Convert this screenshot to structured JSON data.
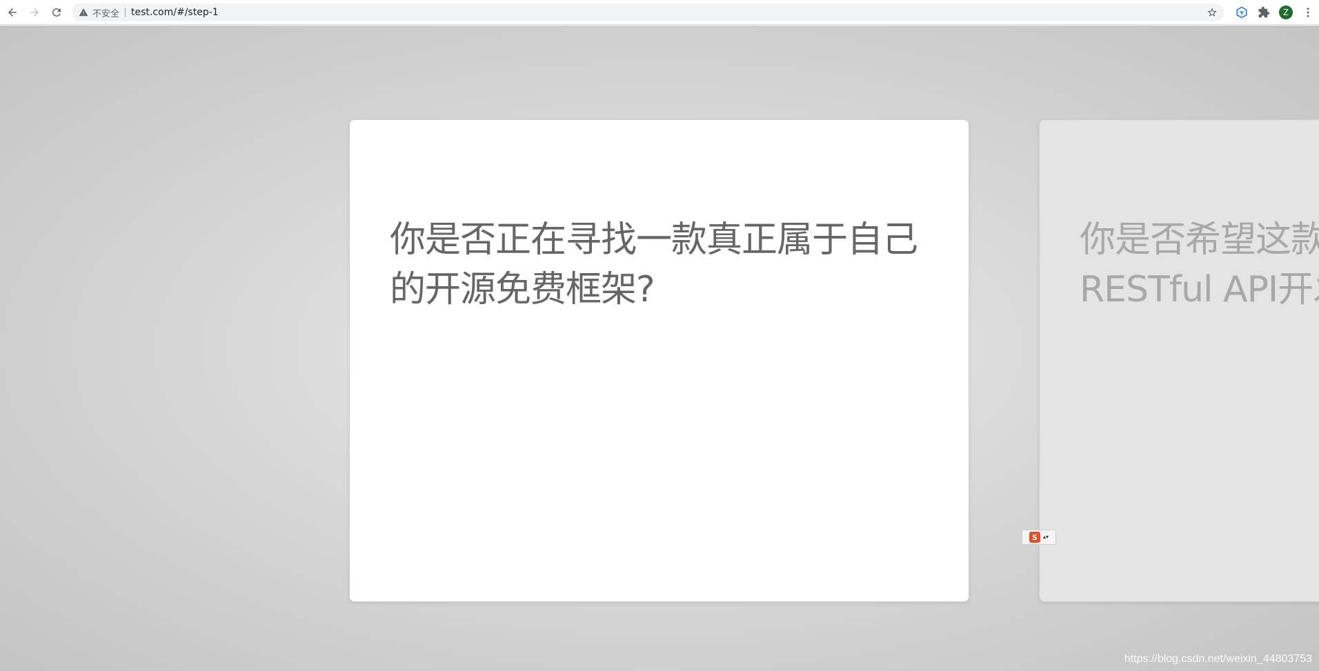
{
  "browser": {
    "security_label": "不安全",
    "url": "test.com/#/step-1",
    "avatar_letter": "Z",
    "icons": [
      "back-icon",
      "forward-icon",
      "reload-icon",
      "warning-icon",
      "bookmark-star-icon",
      "extension-cube-icon",
      "puzzle-icon",
      "menu-dots-icon"
    ]
  },
  "slides": {
    "current": {
      "line1": "你是否正在寻找一款真正属于自己",
      "line2": "的开源免费框架?"
    },
    "next": {
      "line1": "你是否希望这款",
      "line2": "RESTful API开发"
    }
  },
  "ime": {
    "logo_letter": "S",
    "arrows": "▴▾"
  },
  "watermark": "https://blog.csdn.net/weixin_44803753"
}
